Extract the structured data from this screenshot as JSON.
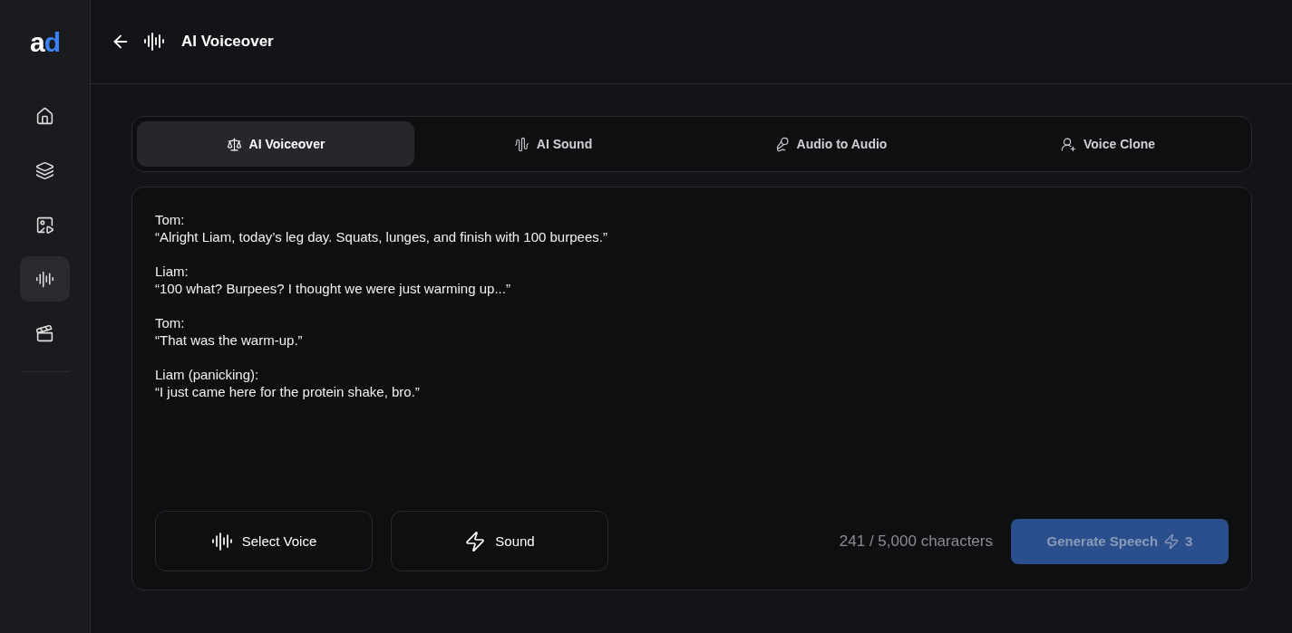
{
  "logo": {
    "letters": [
      {
        "text": "a",
        "color": "#ffffff"
      },
      {
        "text": "d",
        "color": "#3b82f6"
      }
    ]
  },
  "sidebar": {
    "items": [
      {
        "kind": "home",
        "selected": false
      },
      {
        "kind": "layers",
        "selected": false
      },
      {
        "kind": "image",
        "selected": false
      },
      {
        "kind": "wave",
        "selected": true
      },
      {
        "kind": "video",
        "selected": false
      }
    ]
  },
  "header": {
    "title": "AI Voiceover"
  },
  "tabs": [
    {
      "label": "AI Voiceover",
      "kind": "voiceover",
      "selected": true
    },
    {
      "label": "AI Sound",
      "kind": "sound",
      "selected": false
    },
    {
      "label": "Audio to Audio",
      "kind": "audio",
      "selected": false
    },
    {
      "label": "Voice Clone",
      "kind": "clone",
      "selected": false
    }
  ],
  "script": [
    {
      "speaker": "Tom:",
      "line": "“Alright Liam, today’s leg day. Squats, lunges, and finish with 100 burpees.”"
    },
    {
      "speaker": "Liam:",
      "line": "“100 what? Burpees? I thought we were just warming up...”"
    },
    {
      "speaker": "Tom:",
      "line": "“That was the warm-up.”"
    },
    {
      "speaker": "Liam (panicking):",
      "line": "“I just came here for the protein shake, bro.”"
    }
  ],
  "actions": [
    {
      "label": "Select Voice",
      "kind": "wave"
    },
    {
      "label": "Sound",
      "kind": "bolt"
    }
  ],
  "counter": "241 / 5,000 characters",
  "generate": {
    "label": "Generate Speech",
    "cost": "3",
    "disabled": true
  }
}
